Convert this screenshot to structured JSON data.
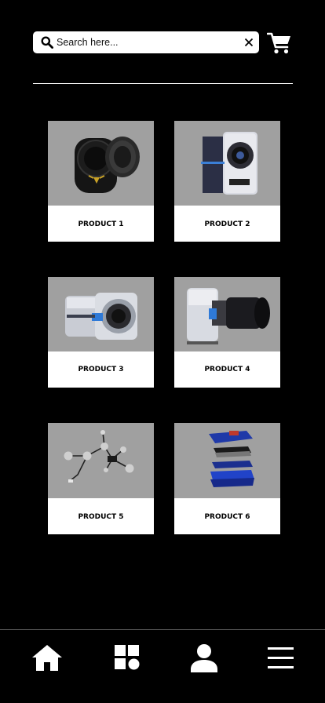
{
  "search": {
    "placeholder": "Search here..."
  },
  "products": [
    {
      "label": "PRODUCT 1"
    },
    {
      "label": "PRODUCT 2"
    },
    {
      "label": "PRODUCT 3"
    },
    {
      "label": "PRODUCT 4"
    },
    {
      "label": "PRODUCT 5"
    },
    {
      "label": "PRODUCT 6"
    }
  ],
  "icons": {
    "search": "search-icon",
    "clear": "close-icon",
    "cart": "shopping-cart-icon",
    "home": "home-icon",
    "categories": "grid-icon",
    "profile": "user-icon",
    "menu": "hamburger-menu-icon"
  },
  "colors": {
    "background": "#000000",
    "image_bg": "#a0a0a0",
    "card": "#ffffff"
  }
}
